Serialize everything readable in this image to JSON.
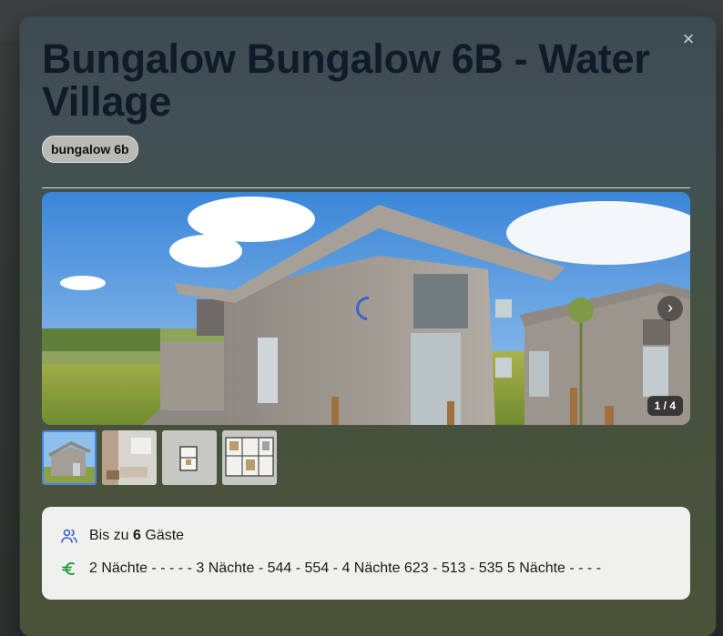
{
  "modal": {
    "title": "Bungalow Bungalow 6B - Water Village",
    "tag": "bungalow 6b",
    "close_glyph": "×"
  },
  "gallery": {
    "counter": "1 / 4",
    "next_glyph": "›",
    "thumbnail_count": 4,
    "active_index": 0
  },
  "info": {
    "guests_prefix": "Bis zu",
    "guests_count": "6",
    "guests_suffix": "Gäste",
    "prices": "2 Nächte - - - - - 3 Nächte - 544 - 554 - 4 Nächte 623 - 513 - 535 5 Nächte - - - -",
    "guests_icon": "users-icon",
    "price_icon": "euro-icon"
  },
  "colors": {
    "title": "#121a2a",
    "accent_blue": "#3c63c9",
    "euro_green": "#1b9a3e",
    "thumb_active": "#4b82e6"
  }
}
